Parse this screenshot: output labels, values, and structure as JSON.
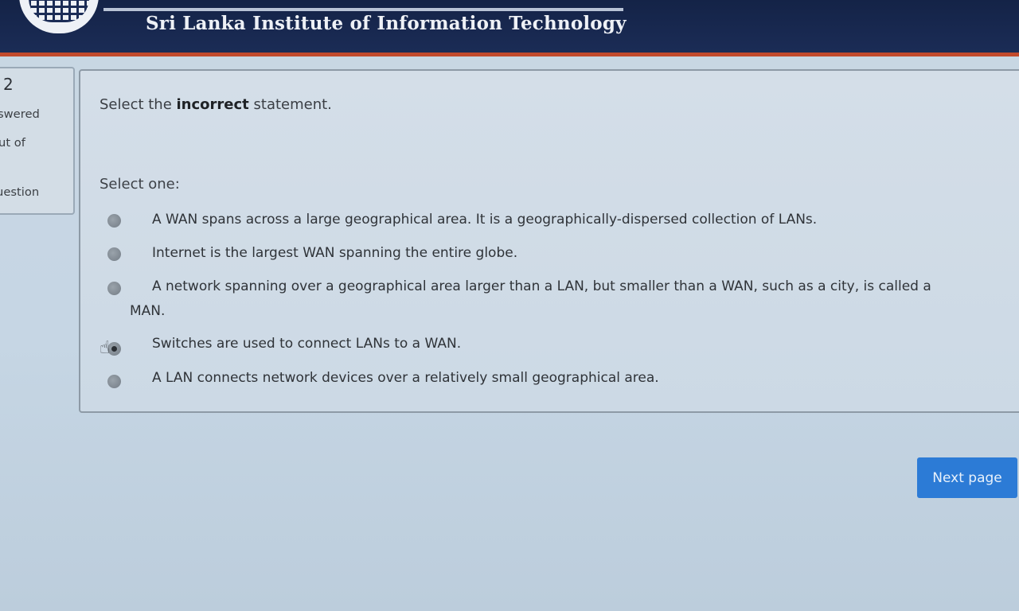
{
  "header": {
    "title": "Sri Lanka Institute of Information Technology",
    "logo": "sliit-logo"
  },
  "info_panel": {
    "number": "2",
    "line1": "swered",
    "line2": "ut of",
    "line3": "uestion"
  },
  "question": {
    "text_before": "Select the ",
    "text_bold": "incorrect",
    "text_after": " statement.",
    "prompt": "Select one:",
    "answers": [
      {
        "label": "A WAN spans across a large geographical area. It is a geographically-dispersed collection of LANs.",
        "checked": false
      },
      {
        "label": "Internet is the largest WAN spanning the entire globe.",
        "checked": false
      },
      {
        "label": "A network spanning over a geographical area larger than a LAN, but smaller than a WAN, such as a city, is called a MAN.",
        "checked": false
      },
      {
        "label": "Switches are used to connect LANs to a WAN.",
        "checked": true
      },
      {
        "label": "A LAN connects network devices over a relatively small geographical area.",
        "checked": false
      }
    ]
  },
  "navigation": {
    "next_label": "Next page"
  },
  "colors": {
    "header_bg": "#1b2c56",
    "header_accent": "#c24a2c",
    "button_bg": "#2c7bd6"
  },
  "icons": {
    "cursor": "hand-pointer-icon"
  }
}
